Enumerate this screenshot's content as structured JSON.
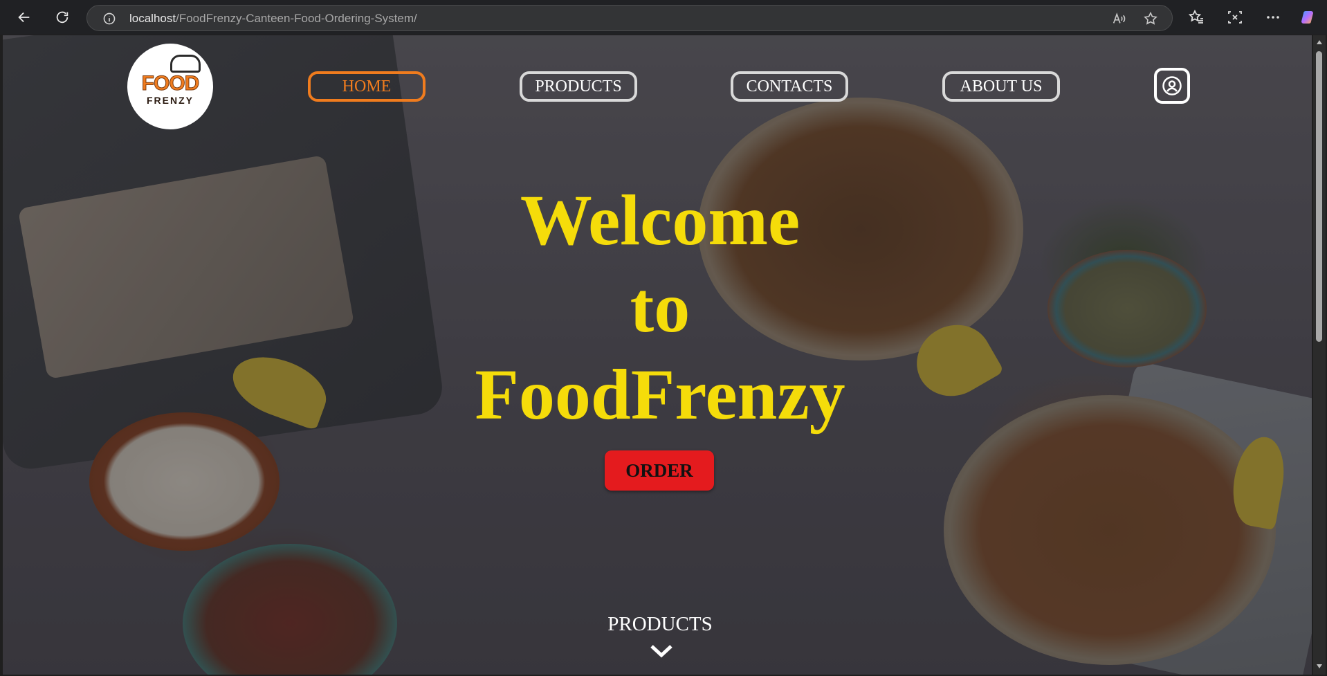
{
  "browser": {
    "url_host": "localhost",
    "url_path": "/FoodFrenzy-Canteen-Food-Ordering-System/",
    "icons": [
      "back-icon",
      "refresh-icon",
      "info-icon",
      "read-aloud-icon",
      "favorite-star-icon",
      "favorites-icon",
      "screenshot-icon",
      "more-icon",
      "copilot-icon"
    ]
  },
  "site": {
    "logo": {
      "line1": "FOOD",
      "line2": "FRENZY"
    },
    "nav": [
      {
        "label": "HOME",
        "active": true
      },
      {
        "label": "PRODUCTS",
        "active": false
      },
      {
        "label": "CONTACTS",
        "active": false
      },
      {
        "label": "ABOUT US",
        "active": false
      }
    ],
    "hero": {
      "line1": "Welcome",
      "line2": "to",
      "line3": "FoodFrenzy"
    },
    "order_button": "ORDER",
    "products_link": "PRODUCTS",
    "colors": {
      "accent": "#f07c1e",
      "hero_text": "#f5dc0a",
      "order_button": "#e41b1e"
    }
  }
}
